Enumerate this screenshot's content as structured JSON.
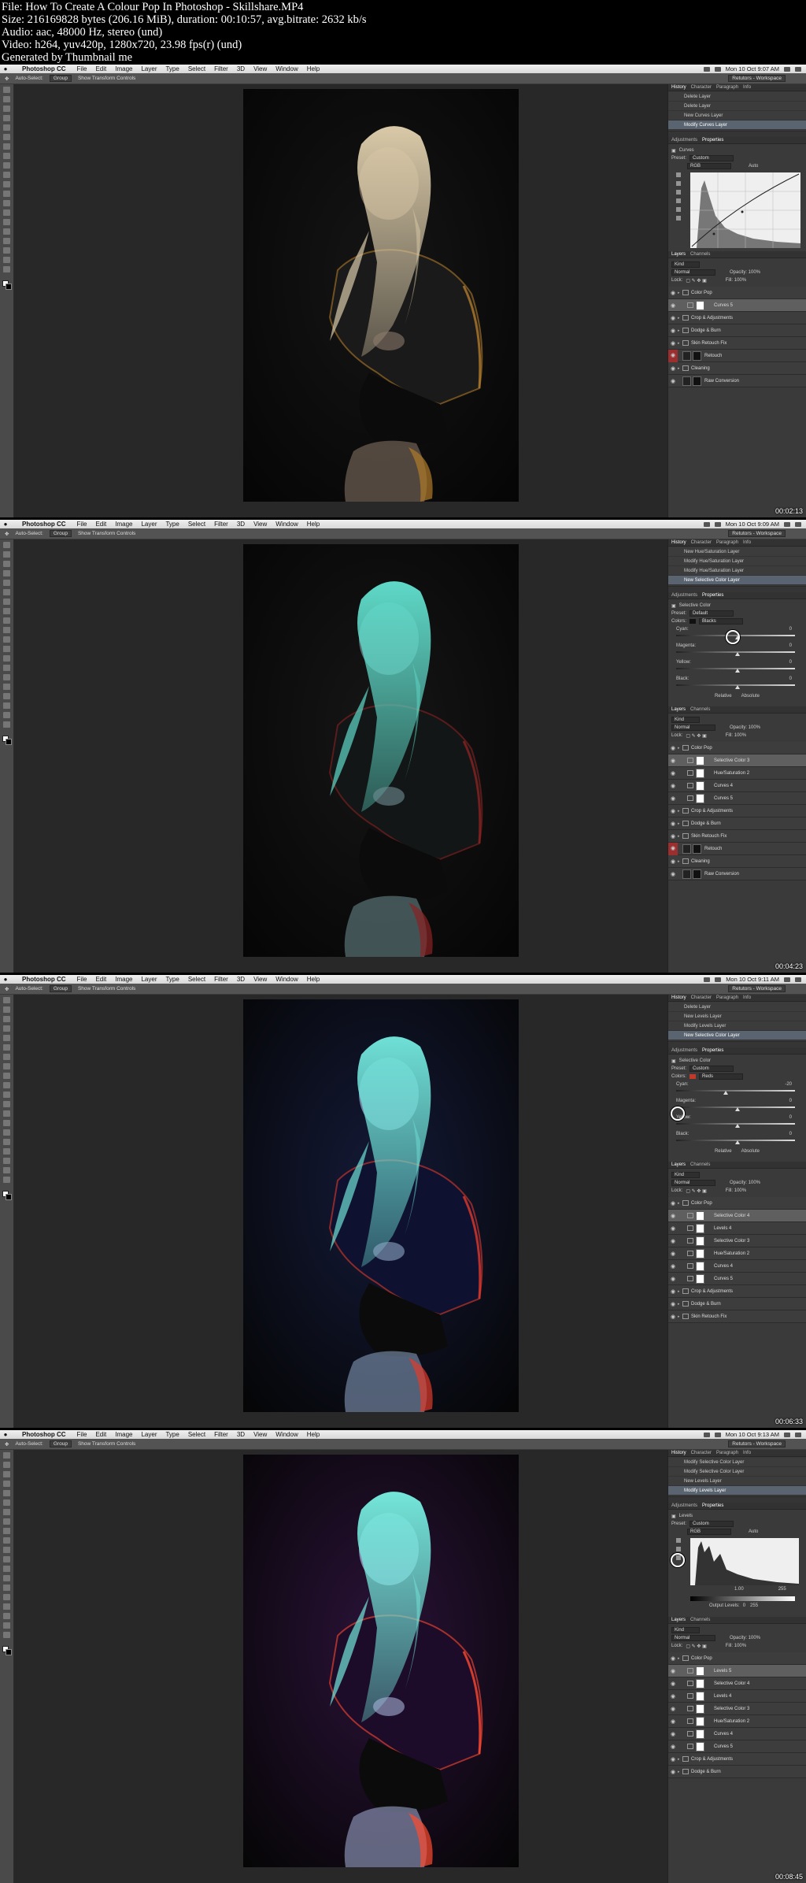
{
  "header": {
    "file": "File: How To Create A Colour Pop In Photoshop - Skillshare.MP4",
    "size": "Size: 216169828 bytes (206.16 MiB), duration: 00:10:57, avg.bitrate: 2632 kb/s",
    "audio": "Audio: aac, 48000 Hz, stereo (und)",
    "video": "Video: h264, yuv420p, 1280x720, 23.98 fps(r) (und)",
    "generated": "Generated by Thumbnail me"
  },
  "menu": {
    "app": "Photoshop CC",
    "items": [
      "File",
      "Edit",
      "Image",
      "Layer",
      "Type",
      "Select",
      "Filter",
      "3D",
      "View",
      "Window",
      "Help"
    ]
  },
  "options": {
    "auto_select": "Auto-Select:",
    "group": "Group",
    "transform": "Show Transform Controls",
    "workspace": "Retutors - Workspace"
  },
  "panel_tabs": {
    "history": [
      "History",
      "Character",
      "Paragraph",
      "Info"
    ],
    "adjust": [
      "Adjustments",
      "Properties"
    ],
    "layers": [
      "Layers",
      "Channels"
    ]
  },
  "layer_controls": {
    "kind": "Kind",
    "blend": "Normal",
    "opacity": "Opacity: 100%",
    "lock": "Lock:",
    "fill": "Fill: 100%"
  },
  "frames": [
    {
      "time": "Mon 10 Oct 9:07 AM",
      "timecode": "00:02:13",
      "history": [
        "Delete Layer",
        "Delete Layer",
        "New Curves Layer",
        "Modify Curves Layer"
      ],
      "history_selected": 3,
      "panel_type": "curves",
      "adj_title": "Curves",
      "preset_label": "Preset:",
      "preset_value": "Custom",
      "channel": "RGB",
      "auto": "Auto",
      "layers": [
        {
          "name": "Color Pop",
          "kind": "group",
          "sel": false
        },
        {
          "name": "Curves 5",
          "kind": "adj",
          "sel": true,
          "indent": true
        },
        {
          "name": "Crop & Adjustments",
          "kind": "group",
          "sel": false
        },
        {
          "name": "Dodge & Burn",
          "kind": "group",
          "sel": false
        },
        {
          "name": "Skin Retouch Fix",
          "kind": "group",
          "sel": false
        },
        {
          "name": "Retouch",
          "kind": "smart",
          "sel": false,
          "red": true
        },
        {
          "name": "Cleaning",
          "kind": "group",
          "sel": false
        },
        {
          "name": "Raw Conversion",
          "kind": "smart",
          "sel": false
        }
      ]
    },
    {
      "time": "Mon 10 Oct 9:09 AM",
      "timecode": "00:04:23",
      "history": [
        "New Hue/Saturation Layer",
        "Modify Hue/Saturation Layer",
        "Modify Hue/Saturation Layer",
        "New Selective Color Layer"
      ],
      "history_selected": 3,
      "panel_type": "selective",
      "adj_title": "Selective Color",
      "preset_label": "Preset:",
      "preset_value": "Default",
      "colors_label": "Colors:",
      "colors_value": "Blacks",
      "colors_swatch": "#111111",
      "sliders": [
        {
          "label": "Cyan:",
          "value": "0",
          "knob": 0.5
        },
        {
          "label": "Magenta:",
          "value": "0",
          "knob": 0.5
        },
        {
          "label": "Yellow:",
          "value": "0",
          "knob": 0.5
        },
        {
          "label": "Black:",
          "value": "0",
          "knob": 0.5
        }
      ],
      "radio_relative": "Relative",
      "radio_absolute": "Absolute",
      "layers": [
        {
          "name": "Color Pop",
          "kind": "group",
          "sel": false
        },
        {
          "name": "Selective Color 3",
          "kind": "adj",
          "sel": true,
          "indent": true
        },
        {
          "name": "Hue/Saturation 2",
          "kind": "adj",
          "sel": false,
          "indent": true
        },
        {
          "name": "Curves 4",
          "kind": "adj",
          "sel": false,
          "indent": true
        },
        {
          "name": "Curves 5",
          "kind": "adj",
          "sel": false,
          "indent": true
        },
        {
          "name": "Crop & Adjustments",
          "kind": "group",
          "sel": false
        },
        {
          "name": "Dodge & Burn",
          "kind": "group",
          "sel": false
        },
        {
          "name": "Skin Retouch Fix",
          "kind": "group",
          "sel": false
        },
        {
          "name": "Retouch",
          "kind": "smart",
          "sel": false,
          "red": true
        },
        {
          "name": "Cleaning",
          "kind": "group",
          "sel": false
        },
        {
          "name": "Raw Conversion",
          "kind": "smart",
          "sel": false
        }
      ]
    },
    {
      "time": "Mon 10 Oct 9:11 AM",
      "timecode": "00:06:33",
      "history": [
        "Delete Layer",
        "New Levels Layer",
        "Modify Levels Layer",
        "New Selective Color Layer"
      ],
      "history_selected": 3,
      "panel_type": "selective",
      "adj_title": "Selective Color",
      "preset_label": "Preset:",
      "preset_value": "Custom",
      "colors_label": "Colors:",
      "colors_value": "Reds",
      "colors_swatch": "#c0392b",
      "sliders": [
        {
          "label": "Cyan:",
          "value": "-20",
          "knob": 0.4
        },
        {
          "label": "Magenta:",
          "value": "0",
          "knob": 0.5
        },
        {
          "label": "Yellow:",
          "value": "0",
          "knob": 0.5
        },
        {
          "label": "Black:",
          "value": "0",
          "knob": 0.5
        }
      ],
      "radio_relative": "Relative",
      "radio_absolute": "Absolute",
      "layers": [
        {
          "name": "Color Pop",
          "kind": "group",
          "sel": false
        },
        {
          "name": "Selective Color 4",
          "kind": "adj",
          "sel": true,
          "indent": true
        },
        {
          "name": "Levels 4",
          "kind": "adj",
          "sel": false,
          "indent": true
        },
        {
          "name": "Selective Color 3",
          "kind": "adj",
          "sel": false,
          "indent": true
        },
        {
          "name": "Hue/Saturation 2",
          "kind": "adj",
          "sel": false,
          "indent": true
        },
        {
          "name": "Curves 4",
          "kind": "adj",
          "sel": false,
          "indent": true
        },
        {
          "name": "Curves 5",
          "kind": "adj",
          "sel": false,
          "indent": true
        },
        {
          "name": "Crop & Adjustments",
          "kind": "group",
          "sel": false
        },
        {
          "name": "Dodge & Burn",
          "kind": "group",
          "sel": false
        },
        {
          "name": "Skin Retouch Fix",
          "kind": "group",
          "sel": false
        }
      ]
    },
    {
      "time": "Mon 10 Oct 9:13 AM",
      "timecode": "00:08:45",
      "history": [
        "Modify Selective Color Layer",
        "Modify Selective Color Layer",
        "New Levels Layer",
        "Modify Levels Layer"
      ],
      "history_selected": 3,
      "panel_type": "levels",
      "adj_title": "Levels",
      "preset_label": "Preset:",
      "preset_value": "Custom",
      "channel": "RGB",
      "auto": "Auto",
      "input_mid": "1.00",
      "input_hi": "255",
      "output_label": "Output Levels:",
      "output_lo": "0",
      "output_hi": "255",
      "layers": [
        {
          "name": "Color Pop",
          "kind": "group",
          "sel": false
        },
        {
          "name": "Levels 5",
          "kind": "adj",
          "sel": true,
          "indent": true
        },
        {
          "name": "Selective Color 4",
          "kind": "adj",
          "sel": false,
          "indent": true
        },
        {
          "name": "Levels 4",
          "kind": "adj",
          "sel": false,
          "indent": true
        },
        {
          "name": "Selective Color 3",
          "kind": "adj",
          "sel": false,
          "indent": true
        },
        {
          "name": "Hue/Saturation 2",
          "kind": "adj",
          "sel": false,
          "indent": true
        },
        {
          "name": "Curves 4",
          "kind": "adj",
          "sel": false,
          "indent": true
        },
        {
          "name": "Curves 5",
          "kind": "adj",
          "sel": false,
          "indent": true
        },
        {
          "name": "Crop & Adjustments",
          "kind": "group",
          "sel": false
        },
        {
          "name": "Dodge & Burn",
          "kind": "group",
          "sel": false
        }
      ]
    }
  ],
  "photo_grades": [
    {
      "bg": "#151515",
      "hair": "#d9c9a8",
      "rim": "#b07a2a",
      "skin": "#8c7a6a",
      "jacket": "#1a1a1a"
    },
    {
      "bg": "#161616",
      "hair": "#5fd9c8",
      "rim": "#8a2222",
      "skin": "#6f8f94",
      "jacket": "#121616"
    },
    {
      "bg": "#141a38",
      "hair": "#6fe0d6",
      "rim": "#e03a2a",
      "skin": "#8fa8c8",
      "jacket": "#0e1230"
    },
    {
      "bg": "#2a1238",
      "hair": "#74e6da",
      "rim": "#ff4a2e",
      "skin": "#a7b2d8",
      "jacket": "#1c0c2a"
    }
  ]
}
